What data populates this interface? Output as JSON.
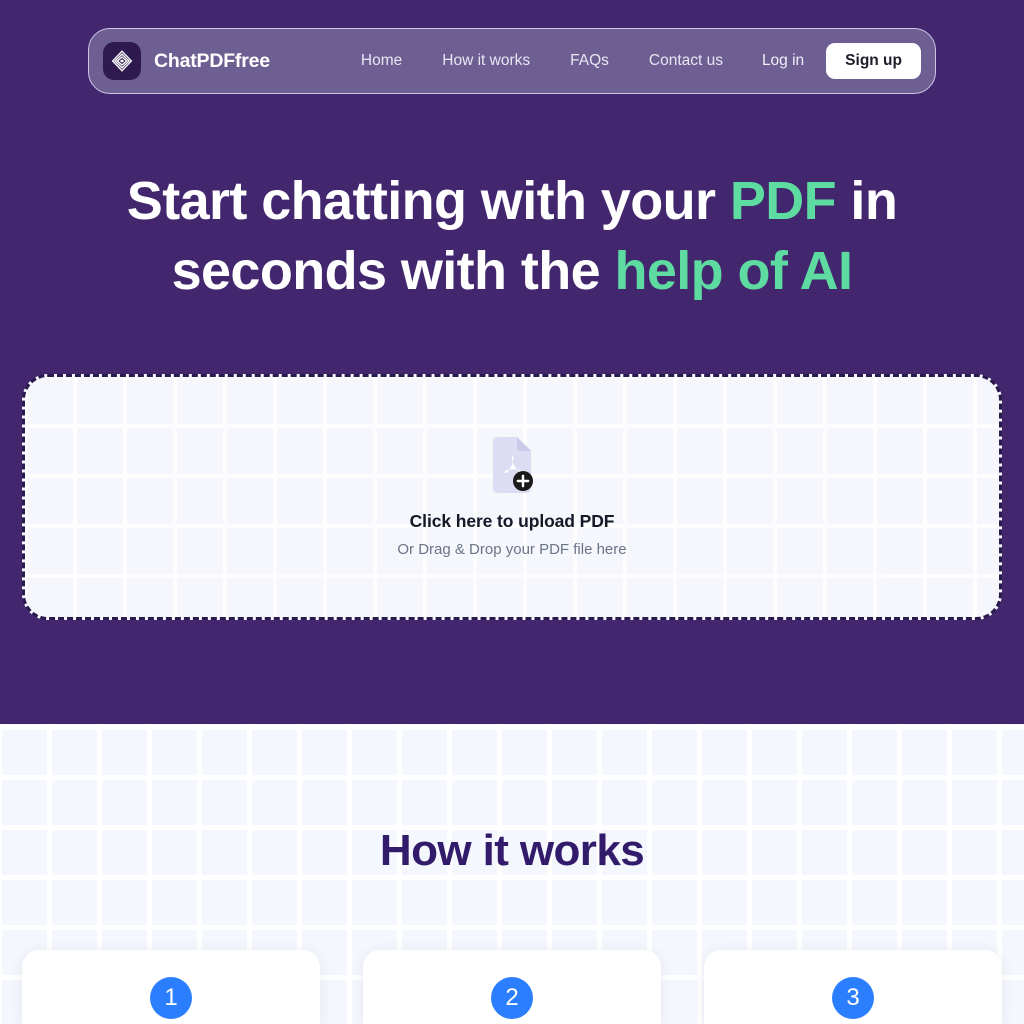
{
  "navbar": {
    "logo_icon": "concentric-diamond-logo-icon",
    "brand": "ChatPDFfree",
    "links": [
      {
        "label": "Home"
      },
      {
        "label": "How it works"
      },
      {
        "label": "FAQs"
      },
      {
        "label": "Contact us"
      }
    ],
    "login_label": "Log in",
    "signup_label": "Sign up"
  },
  "hero": {
    "title_part1": "Start chatting with your ",
    "title_accent1": "PDF",
    "title_part2": " in seconds with the ",
    "title_accent2": "help of AI"
  },
  "upload": {
    "icon": "pdf-file-add-icon",
    "title": "Click here to upload PDF",
    "subtitle": "Or Drag & Drop your PDF file here"
  },
  "how_it_works": {
    "title": "How it works",
    "steps": [
      {
        "number": "1"
      },
      {
        "number": "2"
      },
      {
        "number": "3"
      }
    ]
  },
  "colors": {
    "hero_background": "#42276f",
    "navbar_background": "#6d5f92",
    "accent_green": "#5edba0",
    "step_blue": "#2b7fff",
    "light_background": "#f4f7fd",
    "upload_background": "#f5f7fc",
    "heading_purple": "#331b6b"
  }
}
